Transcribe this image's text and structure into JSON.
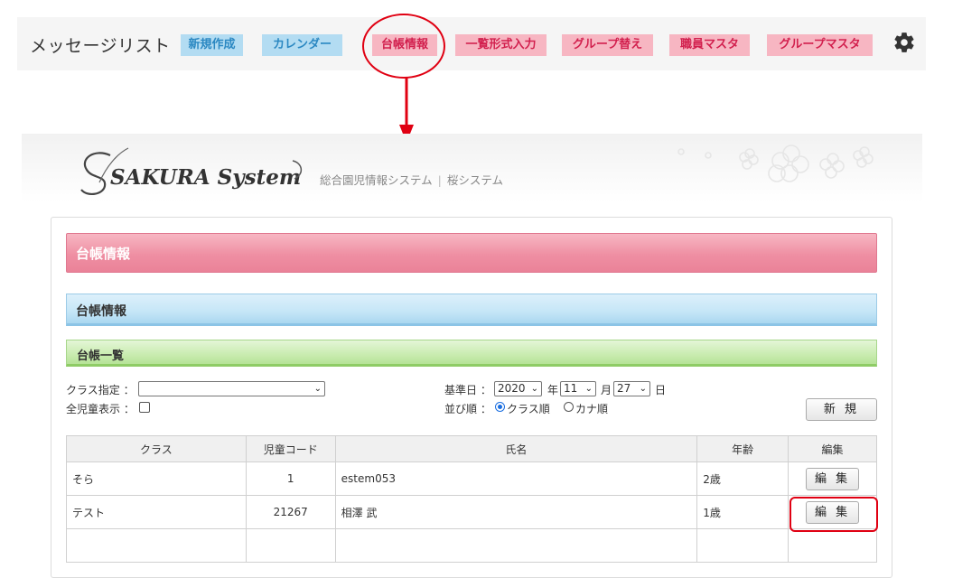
{
  "topbar": {
    "title": "メッセージリスト",
    "nav": [
      {
        "label": "新規作成",
        "style": "blue"
      },
      {
        "label": "カレンダー",
        "style": "blue"
      },
      {
        "label": "台帳情報",
        "style": "pink"
      },
      {
        "label": "一覧形式入力",
        "style": "pink"
      },
      {
        "label": "グループ替え",
        "style": "pink"
      },
      {
        "label": "職員マスタ",
        "style": "pink"
      },
      {
        "label": "グループマスタ",
        "style": "pink"
      }
    ],
    "settings_icon": "gear-icon"
  },
  "system": {
    "logo_text": "SAKURA System",
    "tagline_left": "総合園児情報システム",
    "separator": "|",
    "tagline_right": "桜システム"
  },
  "page": {
    "title": "台帳情報",
    "section_title": "台帳情報",
    "list_title": "台帳一覧"
  },
  "filters": {
    "class_label": "クラス指定 ：",
    "class_value": "",
    "all_children_label": "全児童表示 ：",
    "all_children_checked": false,
    "base_date_label": "基準日 ：",
    "year_value": "2020",
    "year_unit": "年",
    "month_value": "11",
    "month_unit": "月",
    "day_value": "27",
    "day_unit": "日",
    "sort_label": "並び順 ：",
    "sort_options": [
      "クラス順",
      "カナ順"
    ],
    "sort_selected": "クラス順",
    "new_button": "新 規"
  },
  "table": {
    "headers": [
      "クラス",
      "児童コード",
      "氏名",
      "年齢",
      "編集"
    ],
    "rows": [
      {
        "class": "そら",
        "code": "1",
        "name": "estem053",
        "age": "2歳",
        "edit": "編 集"
      },
      {
        "class": "テスト",
        "code": "21267",
        "name": "相澤 武",
        "age": "1歳",
        "edit": "編 集"
      }
    ]
  },
  "colors": {
    "annotation": "#e00012",
    "nav_blue_bg": "#b3dcf2",
    "nav_pink_bg": "#f7b6c2",
    "title_bar_pink": "#ef8fa3",
    "section_bar_blue": "#c5e6f7",
    "list_bar_green": "#c9ecb0"
  }
}
